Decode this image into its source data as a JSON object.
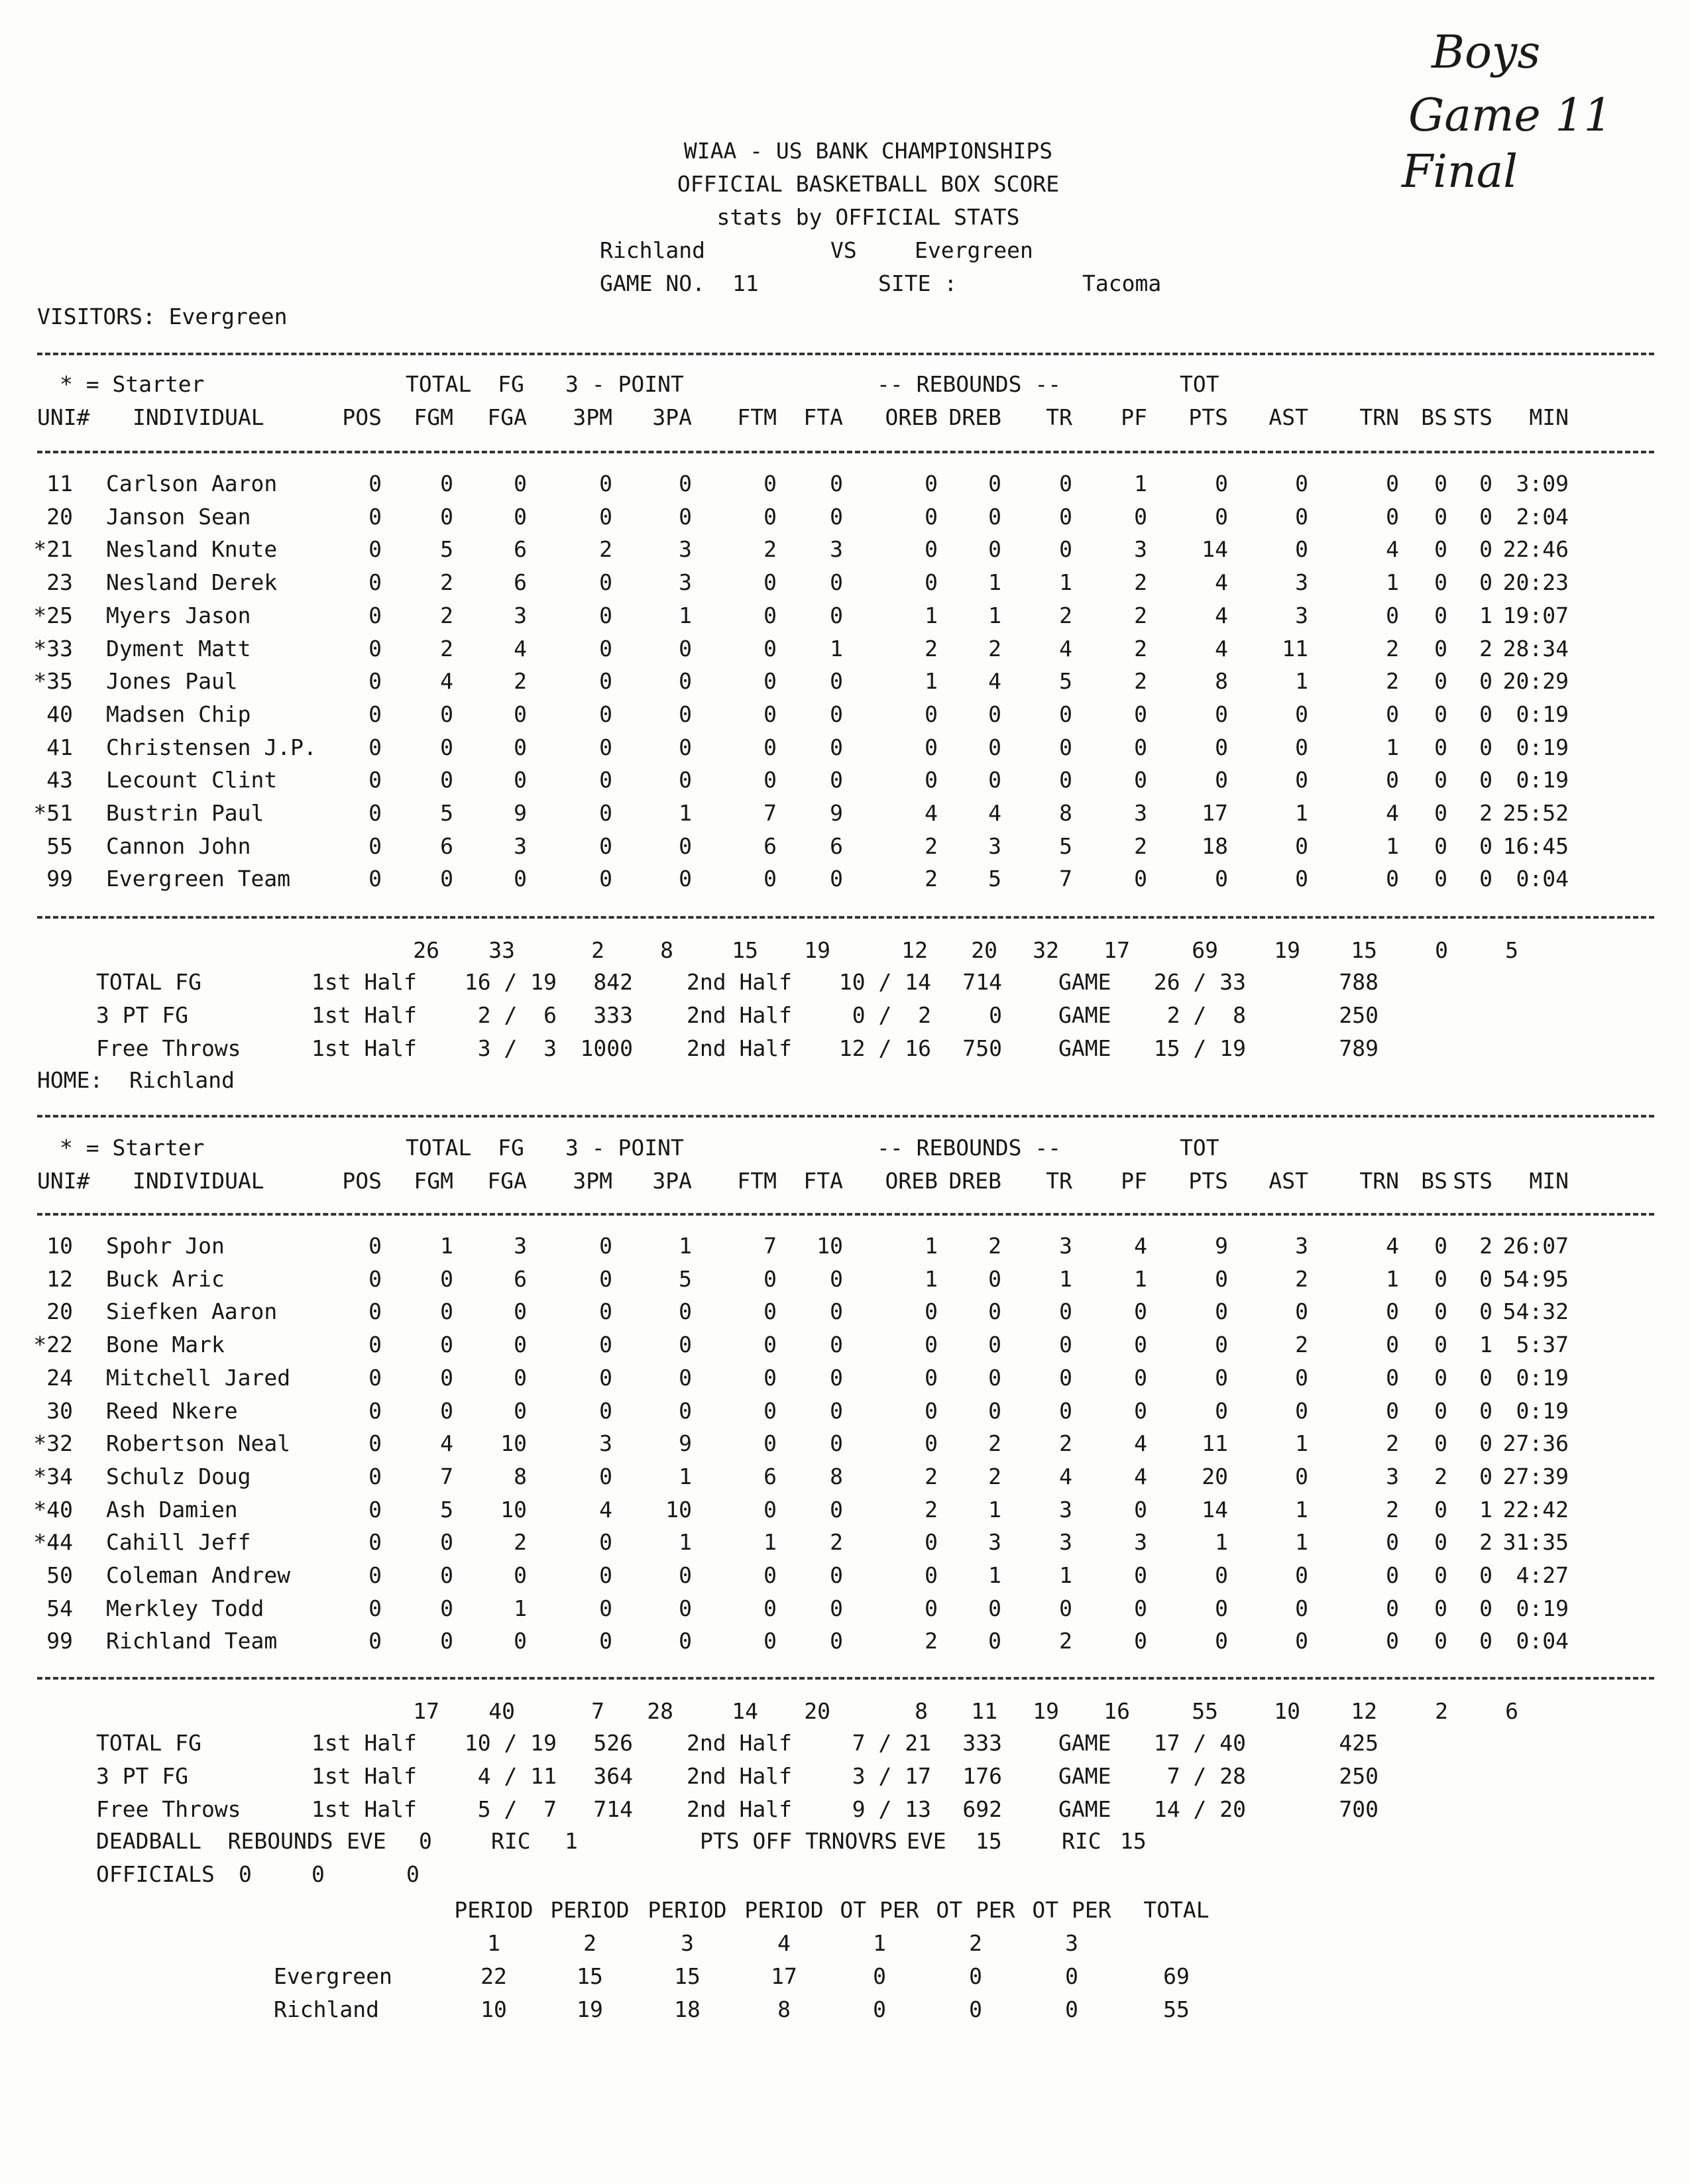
{
  "handwritten": [
    "Boys",
    "Game 11",
    "Final"
  ],
  "header": {
    "line1": "WIAA - US BANK CHAMPIONSHIPS",
    "line2": "OFFICIAL BASKETBALL BOX SCORE",
    "line3": "stats by OFFICIAL STATS",
    "home_name": "Richland",
    "vs": "VS",
    "away_name": "Evergreen",
    "game_no_label": "GAME NO.",
    "game_no": "11",
    "site_label": "SITE :",
    "site": "Tacoma"
  },
  "columns": [
    "POS",
    "FGM",
    "FGA",
    "3PM",
    "3PA",
    "FTM",
    "FTA",
    "OREB",
    "DREB",
    "TR",
    "PF",
    "PTS",
    "AST",
    "TRN",
    "BS",
    "STS",
    "MIN"
  ],
  "col_head1": {
    "starter": "* = Starter",
    "total_fg": "TOTAL  FG",
    "three_point": "3 - POINT",
    "rebounds": "-- REBOUNDS --",
    "tot": "TOT"
  },
  "col_head2": {
    "uni": "UNI#",
    "individual": "INDIVIDUAL"
  },
  "visitors": {
    "label": "VISITORS: Evergreen",
    "players": [
      {
        "uni": "11",
        "name": "Carlson Aaron",
        "stats": [
          "0",
          "0",
          "0",
          "0",
          "0",
          "0",
          "0",
          "0",
          "0",
          "0",
          "1",
          "0",
          "0",
          "0",
          "0",
          "0",
          "3:09"
        ]
      },
      {
        "uni": "20",
        "name": "Janson Sean",
        "stats": [
          "0",
          "0",
          "0",
          "0",
          "0",
          "0",
          "0",
          "0",
          "0",
          "0",
          "0",
          "0",
          "0",
          "0",
          "0",
          "0",
          "2:04"
        ]
      },
      {
        "uni": "*21",
        "name": "Nesland Knute",
        "stats": [
          "0",
          "5",
          "6",
          "2",
          "3",
          "2",
          "3",
          "0",
          "0",
          "0",
          "3",
          "14",
          "0",
          "4",
          "0",
          "0",
          "22:46"
        ]
      },
      {
        "uni": "23",
        "name": "Nesland Derek",
        "stats": [
          "0",
          "2",
          "6",
          "0",
          "3",
          "0",
          "0",
          "0",
          "1",
          "1",
          "2",
          "4",
          "3",
          "1",
          "0",
          "0",
          "20:23"
        ]
      },
      {
        "uni": "*25",
        "name": "Myers Jason",
        "stats": [
          "0",
          "2",
          "3",
          "0",
          "1",
          "0",
          "0",
          "1",
          "1",
          "2",
          "2",
          "4",
          "3",
          "0",
          "0",
          "1",
          "19:07"
        ]
      },
      {
        "uni": "*33",
        "name": "Dyment Matt",
        "stats": [
          "0",
          "2",
          "4",
          "0",
          "0",
          "0",
          "1",
          "2",
          "2",
          "4",
          "2",
          "4",
          "11",
          "2",
          "0",
          "2",
          "28:34"
        ]
      },
      {
        "uni": "*35",
        "name": "Jones Paul",
        "stats": [
          "0",
          "4",
          "2",
          "0",
          "0",
          "0",
          "0",
          "1",
          "4",
          "5",
          "2",
          "8",
          "1",
          "2",
          "0",
          "0",
          "20:29"
        ]
      },
      {
        "uni": "40",
        "name": "Madsen Chip",
        "stats": [
          "0",
          "0",
          "0",
          "0",
          "0",
          "0",
          "0",
          "0",
          "0",
          "0",
          "0",
          "0",
          "0",
          "0",
          "0",
          "0",
          "0:19"
        ]
      },
      {
        "uni": "41",
        "name": "Christensen J.P.",
        "stats": [
          "0",
          "0",
          "0",
          "0",
          "0",
          "0",
          "0",
          "0",
          "0",
          "0",
          "0",
          "0",
          "0",
          "1",
          "0",
          "0",
          "0:19"
        ]
      },
      {
        "uni": "43",
        "name": "Lecount Clint",
        "stats": [
          "0",
          "0",
          "0",
          "0",
          "0",
          "0",
          "0",
          "0",
          "0",
          "0",
          "0",
          "0",
          "0",
          "0",
          "0",
          "0",
          "0:19"
        ]
      },
      {
        "uni": "*51",
        "name": "Bustrin Paul",
        "stats": [
          "0",
          "5",
          "9",
          "0",
          "1",
          "7",
          "9",
          "4",
          "4",
          "8",
          "3",
          "17",
          "1",
          "4",
          "0",
          "2",
          "25:52"
        ]
      },
      {
        "uni": "55",
        "name": "Cannon John",
        "stats": [
          "0",
          "6",
          "3",
          "0",
          "0",
          "6",
          "6",
          "2",
          "3",
          "5",
          "2",
          "18",
          "0",
          "1",
          "0",
          "0",
          "16:45"
        ]
      },
      {
        "uni": "99",
        "name": "Evergreen Team",
        "stats": [
          "0",
          "0",
          "0",
          "0",
          "0",
          "0",
          "0",
          "2",
          "5",
          "7",
          "0",
          "0",
          "0",
          "0",
          "0",
          "0",
          "0:04"
        ]
      }
    ],
    "totals": [
      "26",
      "33",
      "2",
      "8",
      "15",
      "19",
      "12",
      "20",
      "32",
      "17",
      "69",
      "19",
      "15",
      "0",
      "5"
    ],
    "summary": [
      {
        "label": "TOTAL FG",
        "h1": "1st Half",
        "h1v": "16 / 19",
        "h1p": "842",
        "h2": "2nd Half",
        "h2v": "10 / 14",
        "h2p": "714",
        "g": "GAME",
        "gv": "26 / 33",
        "gp": "788"
      },
      {
        "label": "3 PT FG",
        "h1": "1st Half",
        "h1v": "2 /  6",
        "h1p": "333",
        "h2": "2nd Half",
        "h2v": "0 /  2",
        "h2p": "0",
        "g": "GAME",
        "gv": "2 /  8",
        "gp": "250"
      },
      {
        "label": "Free Throws",
        "h1": "1st Half",
        "h1v": "3 /  3",
        "h1p": "1000",
        "h2": "2nd Half",
        "h2v": "12 / 16",
        "h2p": "750",
        "g": "GAME",
        "gv": "15 / 19",
        "gp": "789"
      }
    ]
  },
  "home": {
    "label": "HOME:  Richland",
    "players": [
      {
        "uni": "10",
        "name": "Spohr Jon",
        "stats": [
          "0",
          "1",
          "3",
          "0",
          "1",
          "7",
          "10",
          "1",
          "2",
          "3",
          "4",
          "9",
          "3",
          "4",
          "0",
          "2",
          "26:07"
        ]
      },
      {
        "uni": "12",
        "name": "Buck Aric",
        "stats": [
          "0",
          "0",
          "6",
          "0",
          "5",
          "0",
          "0",
          "1",
          "0",
          "1",
          "1",
          "0",
          "2",
          "1",
          "0",
          "0",
          "54:95"
        ]
      },
      {
        "uni": "20",
        "name": "Siefken Aaron",
        "stats": [
          "0",
          "0",
          "0",
          "0",
          "0",
          "0",
          "0",
          "0",
          "0",
          "0",
          "0",
          "0",
          "0",
          "0",
          "0",
          "0",
          "54:32"
        ]
      },
      {
        "uni": "*22",
        "name": "Bone Mark",
        "stats": [
          "0",
          "0",
          "0",
          "0",
          "0",
          "0",
          "0",
          "0",
          "0",
          "0",
          "0",
          "0",
          "2",
          "0",
          "0",
          "1",
          "5:37"
        ]
      },
      {
        "uni": "24",
        "name": "Mitchell Jared",
        "stats": [
          "0",
          "0",
          "0",
          "0",
          "0",
          "0",
          "0",
          "0",
          "0",
          "0",
          "0",
          "0",
          "0",
          "0",
          "0",
          "0",
          "0:19"
        ]
      },
      {
        "uni": "30",
        "name": "Reed Nkere",
        "stats": [
          "0",
          "0",
          "0",
          "0",
          "0",
          "0",
          "0",
          "0",
          "0",
          "0",
          "0",
          "0",
          "0",
          "0",
          "0",
          "0",
          "0:19"
        ]
      },
      {
        "uni": "*32",
        "name": "Robertson Neal",
        "stats": [
          "0",
          "4",
          "10",
          "3",
          "9",
          "0",
          "0",
          "0",
          "2",
          "2",
          "4",
          "11",
          "1",
          "2",
          "0",
          "0",
          "27:36"
        ]
      },
      {
        "uni": "*34",
        "name": "Schulz Doug",
        "stats": [
          "0",
          "7",
          "8",
          "0",
          "1",
          "6",
          "8",
          "2",
          "2",
          "4",
          "4",
          "20",
          "0",
          "3",
          "2",
          "0",
          "27:39"
        ]
      },
      {
        "uni": "*40",
        "name": "Ash Damien",
        "stats": [
          "0",
          "5",
          "10",
          "4",
          "10",
          "0",
          "0",
          "2",
          "1",
          "3",
          "0",
          "14",
          "1",
          "2",
          "0",
          "1",
          "22:42"
        ]
      },
      {
        "uni": "*44",
        "name": "Cahill Jeff",
        "stats": [
          "0",
          "0",
          "2",
          "0",
          "1",
          "1",
          "2",
          "0",
          "3",
          "3",
          "3",
          "1",
          "1",
          "0",
          "0",
          "2",
          "31:35"
        ]
      },
      {
        "uni": "50",
        "name": "Coleman Andrew",
        "stats": [
          "0",
          "0",
          "0",
          "0",
          "0",
          "0",
          "0",
          "0",
          "1",
          "1",
          "0",
          "0",
          "0",
          "0",
          "0",
          "0",
          "4:27"
        ]
      },
      {
        "uni": "54",
        "name": "Merkley Todd",
        "stats": [
          "0",
          "0",
          "1",
          "0",
          "0",
          "0",
          "0",
          "0",
          "0",
          "0",
          "0",
          "0",
          "0",
          "0",
          "0",
          "0",
          "0:19"
        ]
      },
      {
        "uni": "99",
        "name": "Richland Team",
        "stats": [
          "0",
          "0",
          "0",
          "0",
          "0",
          "0",
          "0",
          "2",
          "0",
          "2",
          "0",
          "0",
          "0",
          "0",
          "0",
          "0",
          "0:04"
        ]
      }
    ],
    "totals": [
      "17",
      "40",
      "7",
      "28",
      "14",
      "20",
      "8",
      "11",
      "19",
      "16",
      "55",
      "10",
      "12",
      "2",
      "6"
    ],
    "summary": [
      {
        "label": "TOTAL FG",
        "h1": "1st Half",
        "h1v": "10 / 19",
        "h1p": "526",
        "h2": "2nd Half",
        "h2v": "7 / 21",
        "h2p": "333",
        "g": "GAME",
        "gv": "17 / 40",
        "gp": "425"
      },
      {
        "label": "3 PT FG",
        "h1": "1st Half",
        "h1v": "4 / 11",
        "h1p": "364",
        "h2": "2nd Half",
        "h2v": "3 / 17",
        "h2p": "176",
        "g": "GAME",
        "gv": "7 / 28",
        "gp": "250"
      },
      {
        "label": "Free Throws",
        "h1": "1st Half",
        "h1v": "5 /  7",
        "h1p": "714",
        "h2": "2nd Half",
        "h2v": "9 / 13",
        "h2p": "692",
        "g": "GAME",
        "gv": "14 / 20",
        "gp": "700"
      }
    ]
  },
  "deadball": {
    "label": "DEADBALL  REBOUNDS",
    "eve_label": "EVE",
    "eve": "0",
    "ric_label": "RIC",
    "ric": "1",
    "pts_label": "PTS OFF TRNOVRS",
    "pts_eve_label": "EVE",
    "pts_eve": "15",
    "pts_ric_label": "RIC",
    "pts_ric": "15"
  },
  "officials": {
    "label": "OFFICIALS",
    "values": [
      "0",
      "0",
      "0"
    ]
  },
  "periods": {
    "headers": [
      "PERIOD",
      "PERIOD",
      "PERIOD",
      "PERIOD",
      "OT PER",
      "OT PER",
      "OT PER",
      "TOTAL"
    ],
    "numbers": [
      "1",
      "2",
      "3",
      "4",
      "1",
      "2",
      "3"
    ],
    "rows": [
      {
        "team": "Evergreen",
        "values": [
          "22",
          "15",
          "15",
          "17",
          "0",
          "0",
          "0",
          "69"
        ]
      },
      {
        "team": "Richland",
        "values": [
          "10",
          "19",
          "18",
          "8",
          "0",
          "0",
          "0",
          "55"
        ]
      }
    ]
  }
}
